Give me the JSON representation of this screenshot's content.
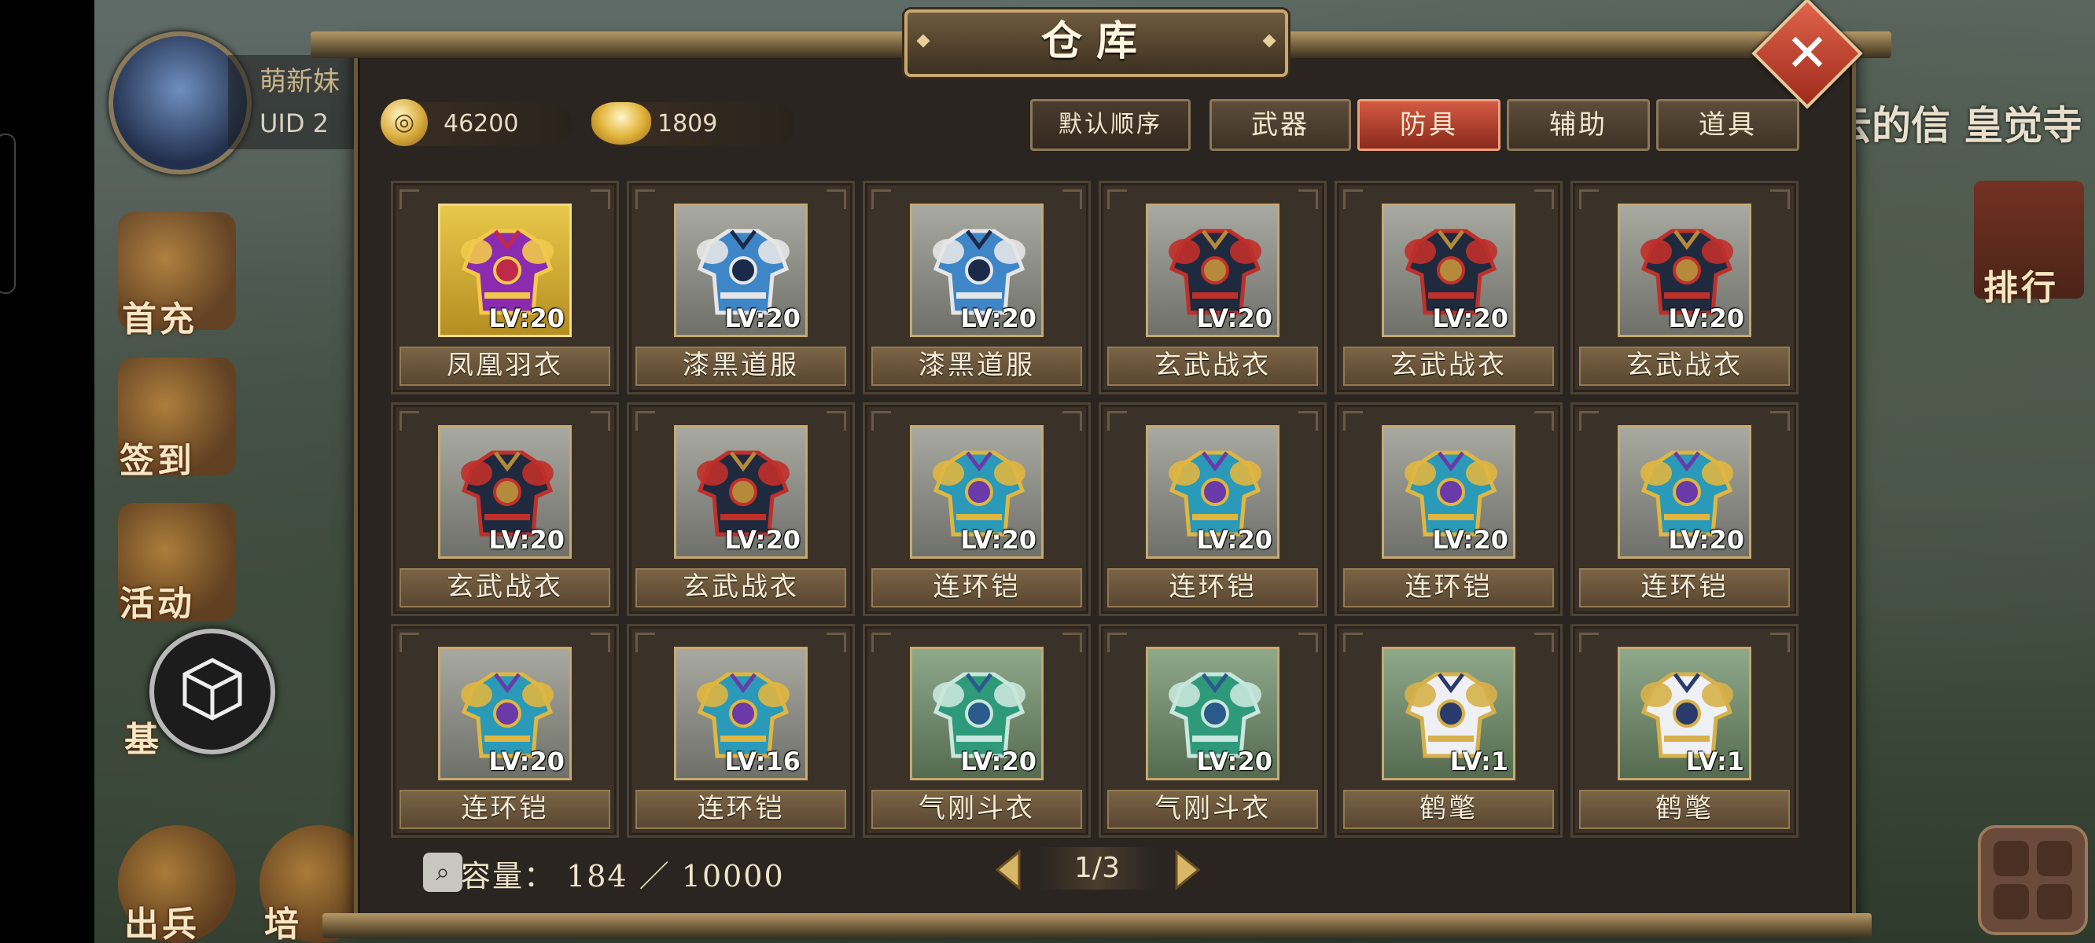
{
  "colors": {
    "panel_bg": "#2a2520",
    "frame_gold": "#c7a970",
    "tab_active": "#d45a44",
    "close_red": "#c84430"
  },
  "hud": {
    "player_name": "萌新妹",
    "uid_label": "UID  2",
    "menu_labels": [
      "首充",
      "签到",
      "活动",
      "基",
      "出兵",
      "培"
    ],
    "right_banner": "云的信 皇觉寺",
    "rank_label": "排行"
  },
  "panel": {
    "title": "仓库",
    "close_icon": "close-icon"
  },
  "currency": {
    "coin": {
      "icon": "coin-icon",
      "value": "46200"
    },
    "ingot": {
      "icon": "ingot-icon",
      "value": "1809"
    }
  },
  "toolbar": {
    "sort_label": "默认顺序",
    "tabs": [
      {
        "label": "武器",
        "active": false
      },
      {
        "label": "防具",
        "active": true
      },
      {
        "label": "辅助",
        "active": false
      },
      {
        "label": "道具",
        "active": false
      }
    ]
  },
  "items": [
    {
      "name": "凤凰羽衣",
      "level": "LV:20",
      "icon": "phoenix-robe-icon"
    },
    {
      "name": "漆黑道服",
      "level": "LV:20",
      "icon": "black-robe-icon"
    },
    {
      "name": "漆黑道服",
      "level": "LV:20",
      "icon": "black-robe-icon"
    },
    {
      "name": "玄武战衣",
      "level": "LV:20",
      "icon": "xuanwu-armor-icon"
    },
    {
      "name": "玄武战衣",
      "level": "LV:20",
      "icon": "xuanwu-armor-icon"
    },
    {
      "name": "玄武战衣",
      "level": "LV:20",
      "icon": "xuanwu-armor-icon"
    },
    {
      "name": "玄武战衣",
      "level": "LV:20",
      "icon": "xuanwu-armor-icon"
    },
    {
      "name": "玄武战衣",
      "level": "LV:20",
      "icon": "xuanwu-armor-icon"
    },
    {
      "name": "连环铠",
      "level": "LV:20",
      "icon": "chain-armor-icon"
    },
    {
      "name": "连环铠",
      "level": "LV:20",
      "icon": "chain-armor-icon"
    },
    {
      "name": "连环铠",
      "level": "LV:20",
      "icon": "chain-armor-icon"
    },
    {
      "name": "连环铠",
      "level": "LV:20",
      "icon": "chain-armor-icon"
    },
    {
      "name": "连环铠",
      "level": "LV:20",
      "icon": "chain-armor-icon"
    },
    {
      "name": "连环铠",
      "level": "LV:16",
      "icon": "chain-armor-icon"
    },
    {
      "name": "气刚斗衣",
      "level": "LV:20",
      "icon": "qigang-armor-icon"
    },
    {
      "name": "气刚斗衣",
      "level": "LV:20",
      "icon": "qigang-armor-icon"
    },
    {
      "name": "鹤氅",
      "level": "LV:1",
      "icon": "crane-cloak-icon"
    },
    {
      "name": "鹤氅",
      "level": "LV:1",
      "icon": "crane-cloak-icon"
    }
  ],
  "footer": {
    "search_icon": "search-icon",
    "capacity_text": "容量： 184 ／ 10000",
    "page_text": "1/3"
  }
}
